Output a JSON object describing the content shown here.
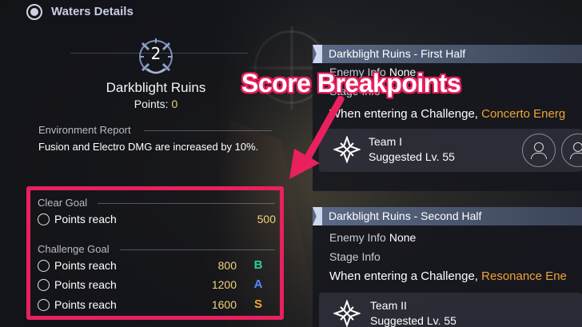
{
  "header": {
    "title": "Waters Details",
    "icon": "waters-globe-icon"
  },
  "emblem": {
    "number": "2",
    "icon": "anchor-emblem-icon"
  },
  "ruin": {
    "name": "Darkblight Ruins",
    "points_label": "Points:",
    "points_value": "0"
  },
  "environment": {
    "title": "Environment Report",
    "text": "Fusion and Electro DMG are increased by 10%."
  },
  "clear_goal": {
    "title": "Clear Goal",
    "rows": [
      {
        "label": "Points reach",
        "points": "500"
      }
    ]
  },
  "challenge_goal": {
    "title": "Challenge Goal",
    "rows": [
      {
        "label": "Points reach",
        "points": "800",
        "grade": "B"
      },
      {
        "label": "Points reach",
        "points": "1200",
        "grade": "A"
      },
      {
        "label": "Points reach",
        "points": "1600",
        "grade": "S"
      }
    ]
  },
  "callout": {
    "title": "Score Breakpoints",
    "color": "#e8215e"
  },
  "cards": [
    {
      "title": "Darkblight Ruins - First Half",
      "enemy_label": "Enemy Info",
      "enemy_value": "None",
      "stage_label": "Stage Info",
      "desc_prefix": "When entering a Challenge,",
      "desc_highlight": "Concerto Energ",
      "team_name": "Team I",
      "team_level": "Suggested Lv. 55"
    },
    {
      "title": "Darkblight Ruins - Second Half",
      "enemy_label": "Enemy Info",
      "enemy_value": "None",
      "stage_label": "Stage Info",
      "desc_prefix": "When entering a Challenge,",
      "desc_highlight": "Resonance Ene",
      "team_name": "Team II",
      "team_level": "Suggested Lv. 55"
    }
  ],
  "colors": {
    "accent_gold": "#f3d27b",
    "highlight_orange": "#f0a437",
    "grade_b": "#27d09a",
    "grade_a": "#4f8dff",
    "grade_s": "#f0a437"
  }
}
